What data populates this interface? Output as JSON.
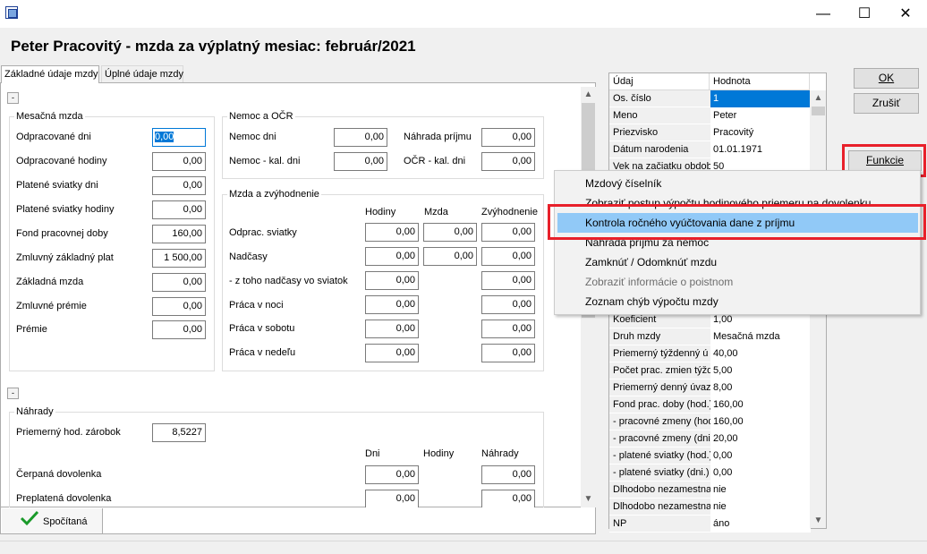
{
  "window": {
    "title_icon": "app-window-icon",
    "minimize": "—",
    "maximize": "☐",
    "close": "✕"
  },
  "title": "Peter Pracovitý - mzda za výplatný mesiac: február/2021",
  "tabs": [
    "Základné údaje mzdy",
    "Úplné údaje mzdy"
  ],
  "section1": {
    "collapse": "-",
    "mesacna": {
      "title": "Mesačná mzda",
      "rows": [
        {
          "label": "Odpracované dni",
          "value": "0,00"
        },
        {
          "label": "Odpracované hodiny",
          "value": "0,00"
        },
        {
          "label": "Platené sviatky dni",
          "value": "0,00"
        },
        {
          "label": "Platené sviatky hodiny",
          "value": "0,00"
        },
        {
          "label": "Fond pracovnej doby",
          "value": "160,00"
        },
        {
          "label": "Zmluvný základný plat",
          "value": "1 500,00"
        },
        {
          "label": "Základná mzda",
          "value": "0,00"
        },
        {
          "label": "Zmluvné prémie",
          "value": "0,00"
        },
        {
          "label": "Prémie",
          "value": "0,00"
        }
      ]
    },
    "nemoc": {
      "title": "Nemoc a OČR",
      "nemoc_dni": {
        "label": "Nemoc dni",
        "value": "0,00"
      },
      "nemoc_kal": {
        "label": "Nemoc - kal. dni",
        "value": "0,00"
      },
      "nahrada": {
        "label": "Náhrada príjmu",
        "value": "0,00"
      },
      "ocr": {
        "label": "OČR - kal. dni",
        "value": "0,00"
      }
    },
    "mzda_zvyhod": {
      "title": "Mzda a zvýhodnenie",
      "headers": [
        "Hodiny",
        "Mzda",
        "Zvýhodnenie"
      ],
      "rows": [
        {
          "label": "Odprac. sviatky",
          "hodiny": "0,00",
          "mzda": "0,00",
          "zvyh": "0,00"
        },
        {
          "label": "Nadčasy",
          "hodiny": "0,00",
          "mzda": "0,00",
          "zvyh": "0,00"
        },
        {
          "label": "- z toho nadčasy vo sviatok",
          "hodiny": "0,00",
          "zvyh": "0,00"
        },
        {
          "label": "Práca v noci",
          "hodiny": "0,00",
          "zvyh": "0,00"
        },
        {
          "label": "Práca v sobotu",
          "hodiny": "0,00",
          "zvyh": "0,00"
        },
        {
          "label": "Práca v nedeľu",
          "hodiny": "0,00",
          "zvyh": "0,00"
        }
      ]
    }
  },
  "section2": {
    "collapse": "-",
    "title": "Náhrady",
    "priemerny": {
      "label": "Priemerný hod. zárobok",
      "value": "8,5227"
    },
    "headers": [
      "Dni",
      "Hodiny",
      "Náhrady"
    ],
    "rows": [
      {
        "label": "Čerpaná dovolenka",
        "dni": "0,00",
        "nahrady": "0,00"
      },
      {
        "label": "Preplatená dovolenka",
        "dni": "0,00",
        "nahrady": "0,00"
      }
    ]
  },
  "status": {
    "label": "Spočítaná",
    "icon": "check-icon"
  },
  "buttons": {
    "ok": "OK",
    "cancel": "Zrušiť",
    "funkcie": "Funkcie"
  },
  "grid": {
    "headers": [
      "Údaj",
      "Hodnota"
    ],
    "rows_top": [
      {
        "k": "Os. číslo",
        "v": "1"
      },
      {
        "k": "Meno",
        "v": "Peter"
      },
      {
        "k": "Priezvisko",
        "v": "Pracovitý"
      },
      {
        "k": "Dátum narodenia",
        "v": "01.01.1971"
      },
      {
        "k": "Vek na začiatku obdob",
        "v": "50"
      }
    ],
    "rows_bottom": [
      {
        "k": "Koeficient",
        "v": "1,00"
      },
      {
        "k": "Druh mzdy",
        "v": "Mesačná mzda"
      },
      {
        "k": "Priemerný týždenný ú",
        "v": "40,00"
      },
      {
        "k": "Počet prac. zmien týžd",
        "v": "5,00"
      },
      {
        "k": "Priemerný denný úvaz",
        "v": "8,00"
      },
      {
        "k": "Fond prac. doby (hod.)",
        "v": "160,00"
      },
      {
        "k": "- pracovné zmeny (hod",
        "v": "160,00"
      },
      {
        "k": "- pracovné zmeny (dni.",
        "v": "20,00"
      },
      {
        "k": "- platené sviatky (hod.)",
        "v": "0,00"
      },
      {
        "k": "- platené sviatky (dni.)",
        "v": "0,00"
      },
      {
        "k": "Dlhodobo nezamestnaı",
        "v": "nie"
      },
      {
        "k": "Dlhodobo nezamestnaı",
        "v": "nie"
      },
      {
        "k": "NP",
        "v": "áno"
      }
    ]
  },
  "menu": [
    {
      "label": "Mzdový číselník",
      "state": "normal"
    },
    {
      "label": "Zobraziť postup výpočtu hodinového priemeru na dovolenku",
      "state": "normal"
    },
    {
      "label": "Kontrola ročného vyúčtovania dane z príjmu",
      "state": "highlighted"
    },
    {
      "label": "Náhrada príjmu za nemoc",
      "state": "normal"
    },
    {
      "label": "Zamknúť / Odomknúť mzdu",
      "state": "normal"
    },
    {
      "label": "Zobraziť informácie o poistnom",
      "state": "disabled"
    },
    {
      "label": "Zoznam chýb výpočtu mzdy",
      "state": "normal"
    }
  ],
  "colors": {
    "highlight": "#91c9f7",
    "annotation": "#e8202a",
    "selection": "#0078d7"
  }
}
